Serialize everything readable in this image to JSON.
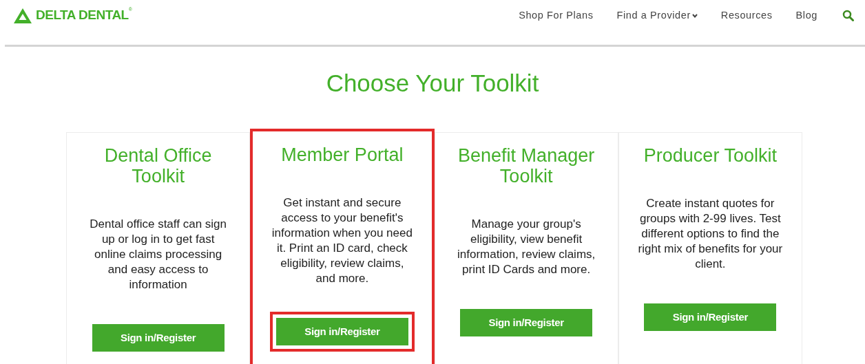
{
  "logo": {
    "text": "DELTA DENTAL",
    "mark": "®"
  },
  "nav": [
    {
      "label": "Shop For Plans",
      "dropdown": false
    },
    {
      "label": "Find a Provider",
      "dropdown": true
    },
    {
      "label": "Resources",
      "dropdown": false
    },
    {
      "label": "Blog",
      "dropdown": false
    }
  ],
  "title": "Choose Your Toolkit",
  "cards": [
    {
      "heading": "Dental Office Toolkit",
      "description": "Dental office staff can sign up or log in to get fast online claims processing and easy access to information",
      "button": "Sign in/Register",
      "highlighted": false
    },
    {
      "heading": "Member Portal",
      "description": "Get instant and secure access to your benefit's information when you need it. Print an ID card, check eligibility, review claims, and more.",
      "button": "Sign in/Register",
      "highlighted": true
    },
    {
      "heading": "Benefit Manager Toolkit",
      "description": "Manage your group's eligibility, view benefit information, review claims, print ID Cards and more.",
      "button": "Sign in/Register",
      "highlighted": false
    },
    {
      "heading": "Producer Toolkit",
      "description": "Create instant quotes for groups with 2-99 lives. Test different options to find the right mix of benefits for your client.",
      "button": "Sign in/Register",
      "highlighted": false
    }
  ]
}
